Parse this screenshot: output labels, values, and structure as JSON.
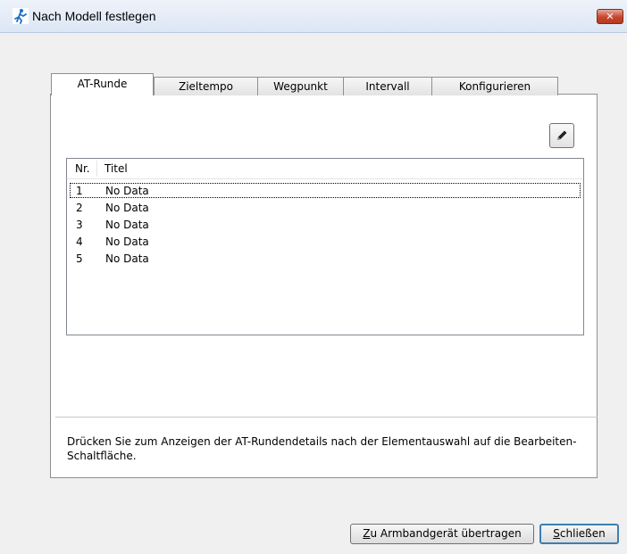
{
  "window": {
    "title": "Nach Modell festlegen",
    "close_symbol": "✕",
    "accent_close": "#c8452c"
  },
  "tabs": [
    {
      "label": "AT-Runde",
      "active": true
    },
    {
      "label": "Zieltempo",
      "active": false
    },
    {
      "label": "Wegpunkt",
      "active": false
    },
    {
      "label": "Intervall",
      "active": false
    },
    {
      "label": "Konfigurieren",
      "active": false
    }
  ],
  "toolbar": {
    "edit_icon": "pencil-icon"
  },
  "list": {
    "columns": [
      "Nr.",
      "Titel"
    ],
    "rows": [
      {
        "nr": "1",
        "title": "No Data"
      },
      {
        "nr": "2",
        "title": "No Data"
      },
      {
        "nr": "3",
        "title": "No Data"
      },
      {
        "nr": "4",
        "title": "No Data"
      },
      {
        "nr": "5",
        "title": "No Data"
      }
    ]
  },
  "hint": "Drücken Sie zum Anzeigen der AT-Rundendetails nach der Elementauswahl auf die Bearbeiten-Schaltfläche.",
  "buttons": {
    "transfer_key": "Z",
    "transfer_rest": "u Armbandgerät übertragen",
    "close_key": "S",
    "close_rest": "chließen"
  }
}
